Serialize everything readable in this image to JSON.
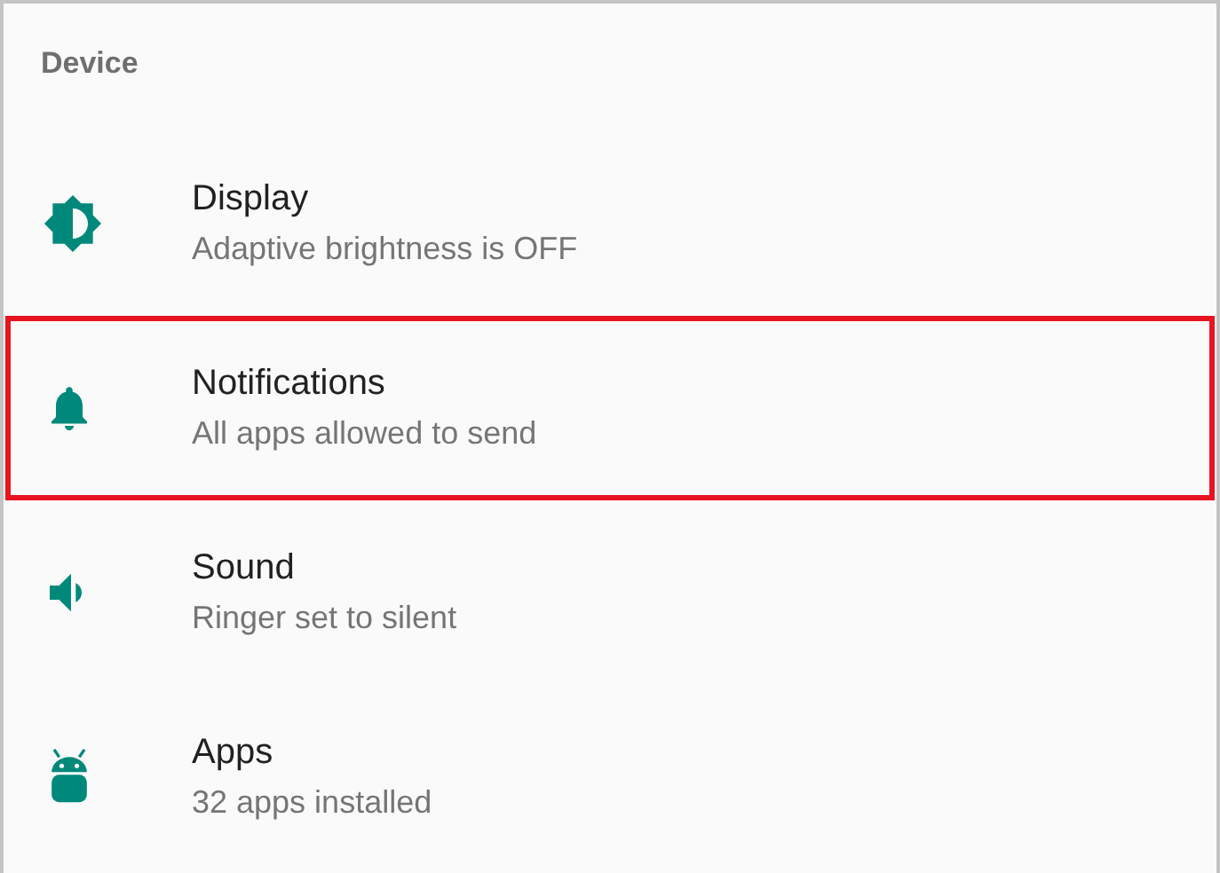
{
  "section": {
    "title": "Device"
  },
  "items": [
    {
      "kind": "display",
      "title": "Display",
      "subtitle": "Adaptive brightness is OFF",
      "highlighted": false
    },
    {
      "kind": "notifications",
      "title": "Notifications",
      "subtitle": "All apps allowed to send",
      "highlighted": true
    },
    {
      "kind": "sound",
      "title": "Sound",
      "subtitle": "Ringer set to silent",
      "highlighted": false
    },
    {
      "kind": "apps",
      "title": "Apps",
      "subtitle": "32 apps installed",
      "highlighted": false
    }
  ]
}
